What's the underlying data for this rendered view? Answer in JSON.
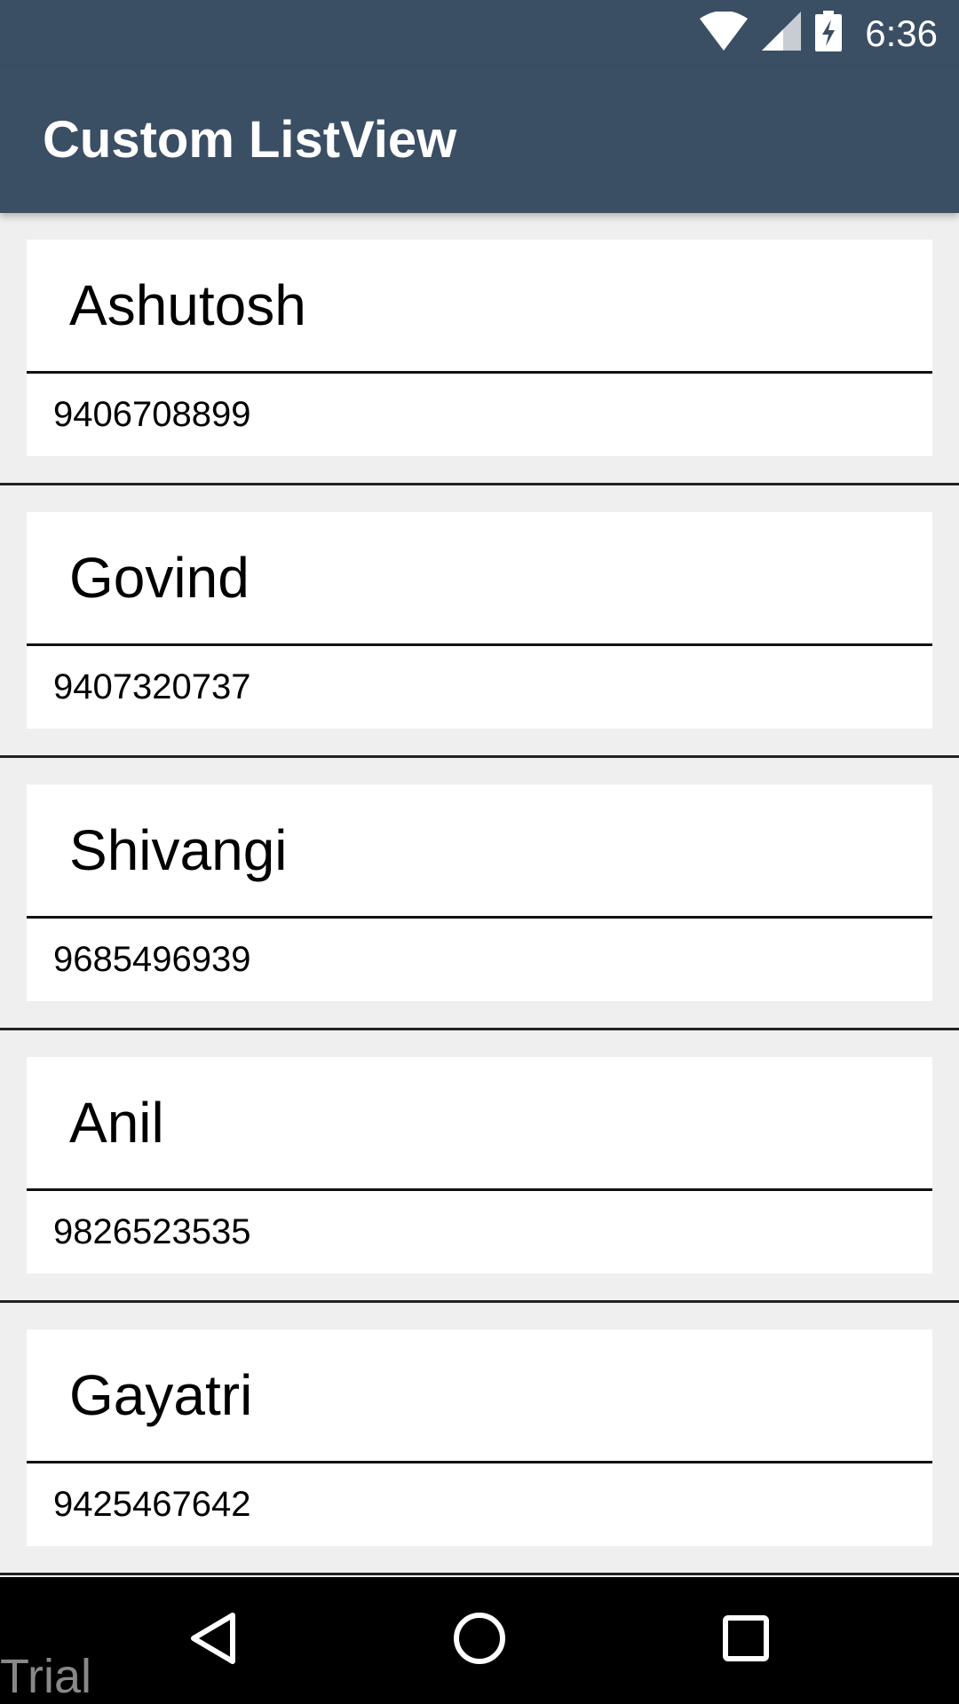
{
  "status_bar": {
    "time": "6:36",
    "icons": [
      "wifi-icon",
      "signal-icon",
      "battery-charging-icon"
    ]
  },
  "app_bar": {
    "title": "Custom ListView"
  },
  "list": {
    "items": [
      {
        "name": "Ashutosh",
        "phone": "9406708899"
      },
      {
        "name": "Govind",
        "phone": "9407320737"
      },
      {
        "name": "Shivangi",
        "phone": "9685496939"
      },
      {
        "name": "Anil",
        "phone": "9826523535"
      },
      {
        "name": "Gayatri",
        "phone": "9425467642"
      }
    ]
  },
  "nav_bar": {
    "buttons": [
      "back-icon",
      "home-icon",
      "recents-icon"
    ]
  },
  "watermark": {
    "text": "Trial"
  },
  "colors": {
    "app_bar": "#3a4e64",
    "background": "#efefef",
    "card": "#ffffff",
    "nav_bar": "#000000"
  }
}
